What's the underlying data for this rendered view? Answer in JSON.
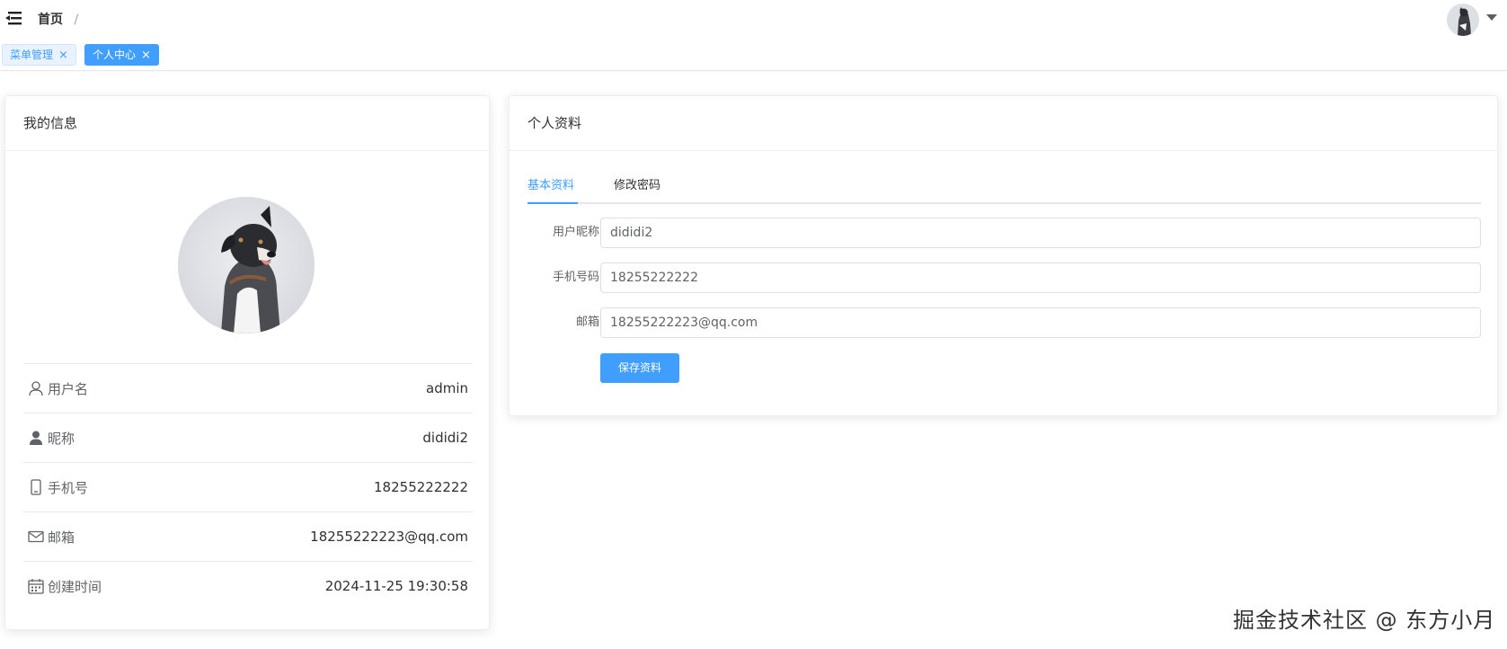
{
  "navbar": {
    "breadcrumb": {
      "home": "首页",
      "separator": "/"
    }
  },
  "tags": [
    {
      "label": "菜单管理",
      "close": "×"
    },
    {
      "label": "个人中心",
      "close": "×"
    }
  ],
  "profile_card": {
    "title": "我的信息",
    "rows": [
      {
        "icon": "user-outline-icon",
        "label": "用户名",
        "value": "admin"
      },
      {
        "icon": "user-solid-icon",
        "label": "昵称",
        "value": "dididi2"
      },
      {
        "icon": "phone-icon",
        "label": "手机号",
        "value": "18255222222"
      },
      {
        "icon": "mail-icon",
        "label": "邮箱",
        "value": "18255222223@qq.com"
      },
      {
        "icon": "calendar-icon",
        "label": "创建时间",
        "value": "2024-11-25 19:30:58"
      }
    ]
  },
  "settings_card": {
    "title": "个人资料",
    "tabs": [
      {
        "label": "基本资料"
      },
      {
        "label": "修改密码"
      }
    ],
    "form": {
      "nickname": {
        "label": "用户昵称",
        "value": "dididi2"
      },
      "phone": {
        "label": "手机号码",
        "value": "18255222222"
      },
      "email": {
        "label": "邮箱",
        "value": "18255222223@qq.com"
      },
      "save_label": "保存资料"
    }
  },
  "watermark": "掘金技术社区 @ 东方小月",
  "colors": {
    "primary": "#409eff",
    "tag_light_bg": "#e8f3ff",
    "border": "#ebeef5"
  }
}
